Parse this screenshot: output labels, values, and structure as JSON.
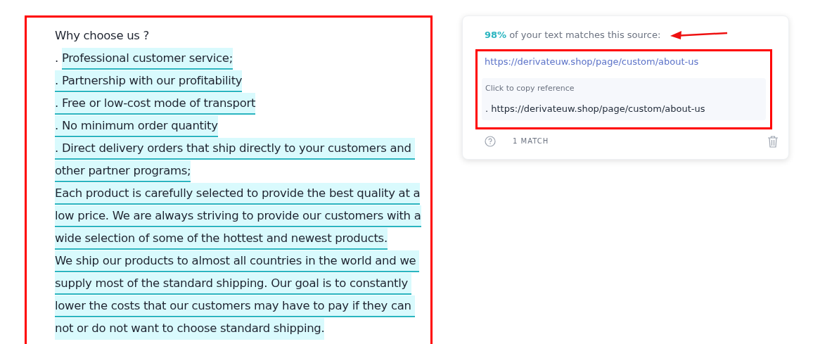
{
  "document": {
    "lines": [
      {
        "segments": [
          {
            "text": "Why choose us ?",
            "highlighted": false,
            "underlined": false
          }
        ]
      },
      {
        "segments": [
          {
            "text": ". ",
            "highlighted": false,
            "underlined": false
          },
          {
            "text": "Professional customer service;",
            "highlighted": true,
            "underlined": true
          }
        ]
      },
      {
        "segments": [
          {
            "text": ". Partnership with our profitability",
            "highlighted": true,
            "underlined": true
          }
        ]
      },
      {
        "segments": [
          {
            "text": ". Free or low-cost mode of transport",
            "highlighted": true,
            "underlined": true
          }
        ]
      },
      {
        "segments": [
          {
            "text": ". No minimum order quantity",
            "highlighted": true,
            "underlined": true
          }
        ]
      },
      {
        "segments": [
          {
            "text": ". Direct delivery orders that ship directly to your customers and ",
            "highlighted": true,
            "underlined": true
          }
        ]
      },
      {
        "segments": [
          {
            "text": "other partner programs;",
            "highlighted": true,
            "underlined": true
          }
        ]
      },
      {
        "segments": [
          {
            "text": "Each product is carefully selected to provide the best quality at a",
            "highlighted": true,
            "underlined": true
          }
        ]
      },
      {
        "segments": [
          {
            "text": "low price. We are always striving to provide our customers with a",
            "highlighted": true,
            "underlined": true
          }
        ]
      },
      {
        "segments": [
          {
            "text": "wide selection of some of the hottest and newest products.",
            "highlighted": true,
            "underlined": true
          }
        ]
      },
      {
        "segments": [
          {
            "text": "We ship our products to almost all countries in the world and we ",
            "highlighted": true,
            "underlined": true
          }
        ]
      },
      {
        "segments": [
          {
            "text": "supply most of the standard shipping. Our goal is to constantly ",
            "highlighted": true,
            "underlined": true
          }
        ]
      },
      {
        "segments": [
          {
            "text": "lower the costs that our customers may have to pay if they can ",
            "highlighted": true,
            "underlined": true
          }
        ]
      },
      {
        "segments": [
          {
            "text": "not or do not want to choose standard shipping.",
            "highlighted": true,
            "underlined": false
          }
        ]
      }
    ]
  },
  "match_card": {
    "percent": "98%",
    "summary": "of your text matches this source:",
    "source_url": "https://derivateuw.shop/page/custom/about-us",
    "copy_hint": "Click to copy reference",
    "reference": ". https://derivateuw.shop/page/custom/about-us",
    "match_count": "1 MATCH"
  }
}
